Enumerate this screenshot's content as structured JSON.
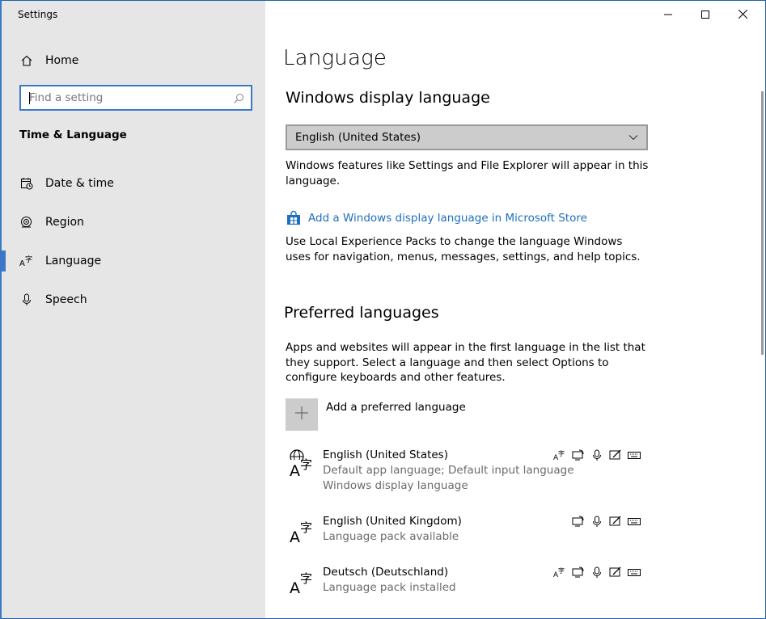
{
  "app": {
    "title": "Settings"
  },
  "sidebar": {
    "home_label": "Home",
    "search_placeholder": "Find a setting",
    "section_title": "Time & Language",
    "items": [
      {
        "label": "Date & time",
        "icon": "calendar-clock-icon"
      },
      {
        "label": "Region",
        "icon": "globe-icon"
      },
      {
        "label": "Language",
        "icon": "language-icon",
        "active": true
      },
      {
        "label": "Speech",
        "icon": "microphone-icon"
      }
    ]
  },
  "main": {
    "page_title": "Language",
    "display_language": {
      "heading": "Windows display language",
      "selected": "English (United States)",
      "description": "Windows features like Settings and File Explorer will appear in this language.",
      "store_link": "Add a Windows display language in Microsoft Store",
      "lxp_description": "Use Local Experience Packs to change the language Windows uses for navigation, menus, messages, settings, and help topics."
    },
    "preferred": {
      "heading": "Preferred languages",
      "description": "Apps and websites will appear in the first language in the list that they support. Select a language and then select Options to configure keyboards and other features.",
      "add_label": "Add a preferred language",
      "languages": [
        {
          "name": "English (United States)",
          "line1": "Default app language; Default input language",
          "line2": "Windows display language"
        },
        {
          "name": "English (United Kingdom)",
          "line1": "Language pack available"
        },
        {
          "name": "Deutsch (Deutschland)",
          "line1": "Language pack installed"
        }
      ]
    }
  },
  "colors": {
    "accent": "#3a78c8",
    "link": "#1f6fbf",
    "sidebar_bg": "#e6e6e6"
  }
}
